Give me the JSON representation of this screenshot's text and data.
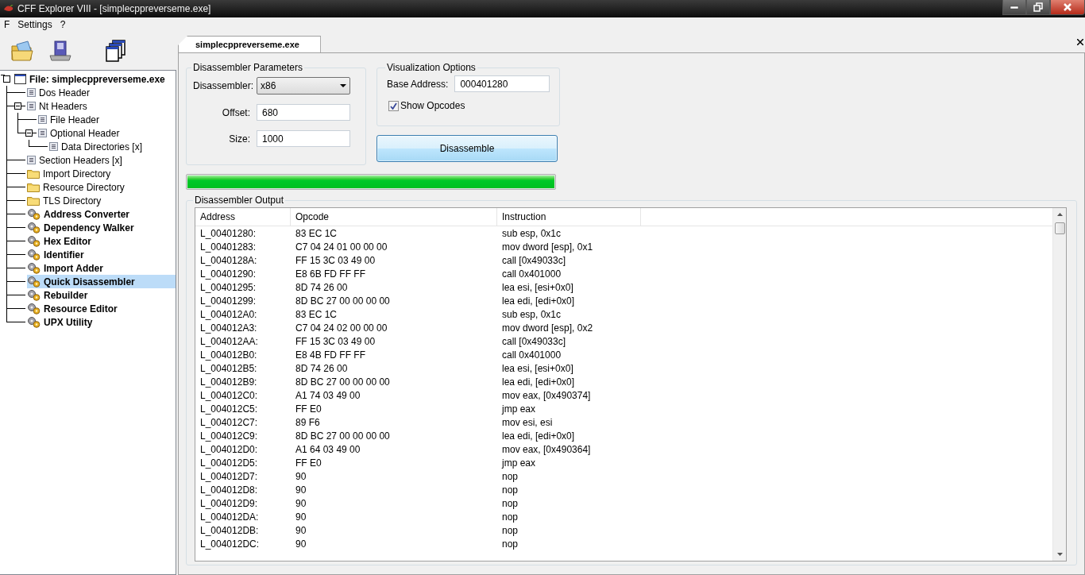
{
  "window": {
    "title": "CFF Explorer VIII - [simplecppreverseme.exe]"
  },
  "menu": [
    "F",
    "Settings",
    "?"
  ],
  "tree": {
    "label": "File: simplecppreverseme.exe",
    "kind": "file",
    "selected": false,
    "expanded": true,
    "children": [
      {
        "label": "Dos Header",
        "kind": "page",
        "selected": false
      },
      {
        "label": "Nt Headers",
        "kind": "page",
        "selected": false,
        "expanded": true,
        "children": [
          {
            "label": "File Header",
            "kind": "page",
            "selected": false
          },
          {
            "label": "Optional Header",
            "kind": "page",
            "selected": false,
            "expanded": true,
            "children": [
              {
                "label": "Data Directories [x]",
                "kind": "page",
                "selected": false
              }
            ]
          }
        ]
      },
      {
        "label": "Section Headers [x]",
        "kind": "page",
        "selected": false
      },
      {
        "label": "Import Directory",
        "kind": "folder",
        "selected": false
      },
      {
        "label": "Resource Directory",
        "kind": "folder",
        "selected": false
      },
      {
        "label": "TLS Directory",
        "kind": "folder",
        "selected": false
      },
      {
        "label": "Address Converter",
        "kind": "tool",
        "selected": false
      },
      {
        "label": "Dependency Walker",
        "kind": "tool",
        "selected": false
      },
      {
        "label": "Hex Editor",
        "kind": "tool",
        "selected": false
      },
      {
        "label": "Identifier",
        "kind": "tool",
        "selected": false
      },
      {
        "label": "Import Adder",
        "kind": "tool",
        "selected": false
      },
      {
        "label": "Quick Disassembler",
        "kind": "tool",
        "selected": true
      },
      {
        "label": "Rebuilder",
        "kind": "tool",
        "selected": false
      },
      {
        "label": "Resource Editor",
        "kind": "tool",
        "selected": false
      },
      {
        "label": "UPX Utility",
        "kind": "tool",
        "selected": false
      }
    ]
  },
  "tabs": [
    {
      "label": "simplecppreverseme.exe",
      "selected": true
    }
  ],
  "disassembler_parameters": {
    "title": "Disassembler Parameters",
    "fields": [
      {
        "label": "Disassembler:",
        "kind": "dropdown",
        "value": "x86"
      },
      {
        "label": "Offset:",
        "kind": "text",
        "value": "680"
      },
      {
        "label": "Size:",
        "kind": "text",
        "value": "1000"
      }
    ]
  },
  "visualization_options": {
    "title": "Visualization Options",
    "base_address": {
      "label": "Base Address:",
      "value": "000401280"
    },
    "show_opcodes": {
      "label": "Show Opcodes",
      "checked": true
    }
  },
  "disassemble_button": "Disassemble",
  "progress": {
    "level": 1
  },
  "output": {
    "title": "Disassembler Output",
    "columns": [
      "Address",
      "Opcode",
      "Instruction"
    ],
    "rows": [
      [
        "L_00401280:",
        "83 EC 1C",
        "sub esp, 0x1c"
      ],
      [
        "L_00401283:",
        "C7 04 24 01 00 00 00",
        "mov dword [esp], 0x1"
      ],
      [
        "L_0040128A:",
        "FF 15 3C 03 49 00",
        "call [0x49033c]"
      ],
      [
        "L_00401290:",
        "E8 6B FD FF FF",
        "call 0x401000"
      ],
      [
        "L_00401295:",
        "8D 74 26 00",
        "lea esi, [esi+0x0]"
      ],
      [
        "L_00401299:",
        "8D BC 27 00 00 00 00",
        "lea edi, [edi+0x0]"
      ],
      [
        "L_004012A0:",
        "83 EC 1C",
        "sub esp, 0x1c"
      ],
      [
        "L_004012A3:",
        "C7 04 24 02 00 00 00",
        "mov dword [esp], 0x2"
      ],
      [
        "L_004012AA:",
        "FF 15 3C 03 49 00",
        "call [0x49033c]"
      ],
      [
        "L_004012B0:",
        "E8 4B FD FF FF",
        "call 0x401000"
      ],
      [
        "L_004012B5:",
        "8D 74 26 00",
        "lea esi, [esi+0x0]"
      ],
      [
        "L_004012B9:",
        "8D BC 27 00 00 00 00",
        "lea edi, [edi+0x0]"
      ],
      [
        "L_004012C0:",
        "A1 74 03 49 00",
        "mov eax, [0x490374]"
      ],
      [
        "L_004012C5:",
        "FF E0",
        "jmp eax"
      ],
      [
        "L_004012C7:",
        "89 F6",
        "mov esi, esi"
      ],
      [
        "L_004012C9:",
        "8D BC 27 00 00 00 00",
        "lea edi, [edi+0x0]"
      ],
      [
        "L_004012D0:",
        "A1 64 03 49 00",
        "mov eax, [0x490364]"
      ],
      [
        "L_004012D5:",
        "FF E0",
        "jmp eax"
      ],
      [
        "L_004012D7:",
        "90",
        "nop"
      ],
      [
        "L_004012D8:",
        "90",
        "nop"
      ],
      [
        "L_004012D9:",
        "90",
        "nop"
      ],
      [
        "L_004012DA:",
        "90",
        "nop"
      ],
      [
        "L_004012DB:",
        "90",
        "nop"
      ],
      [
        "L_004012DC:",
        "90",
        "nop"
      ]
    ]
  }
}
